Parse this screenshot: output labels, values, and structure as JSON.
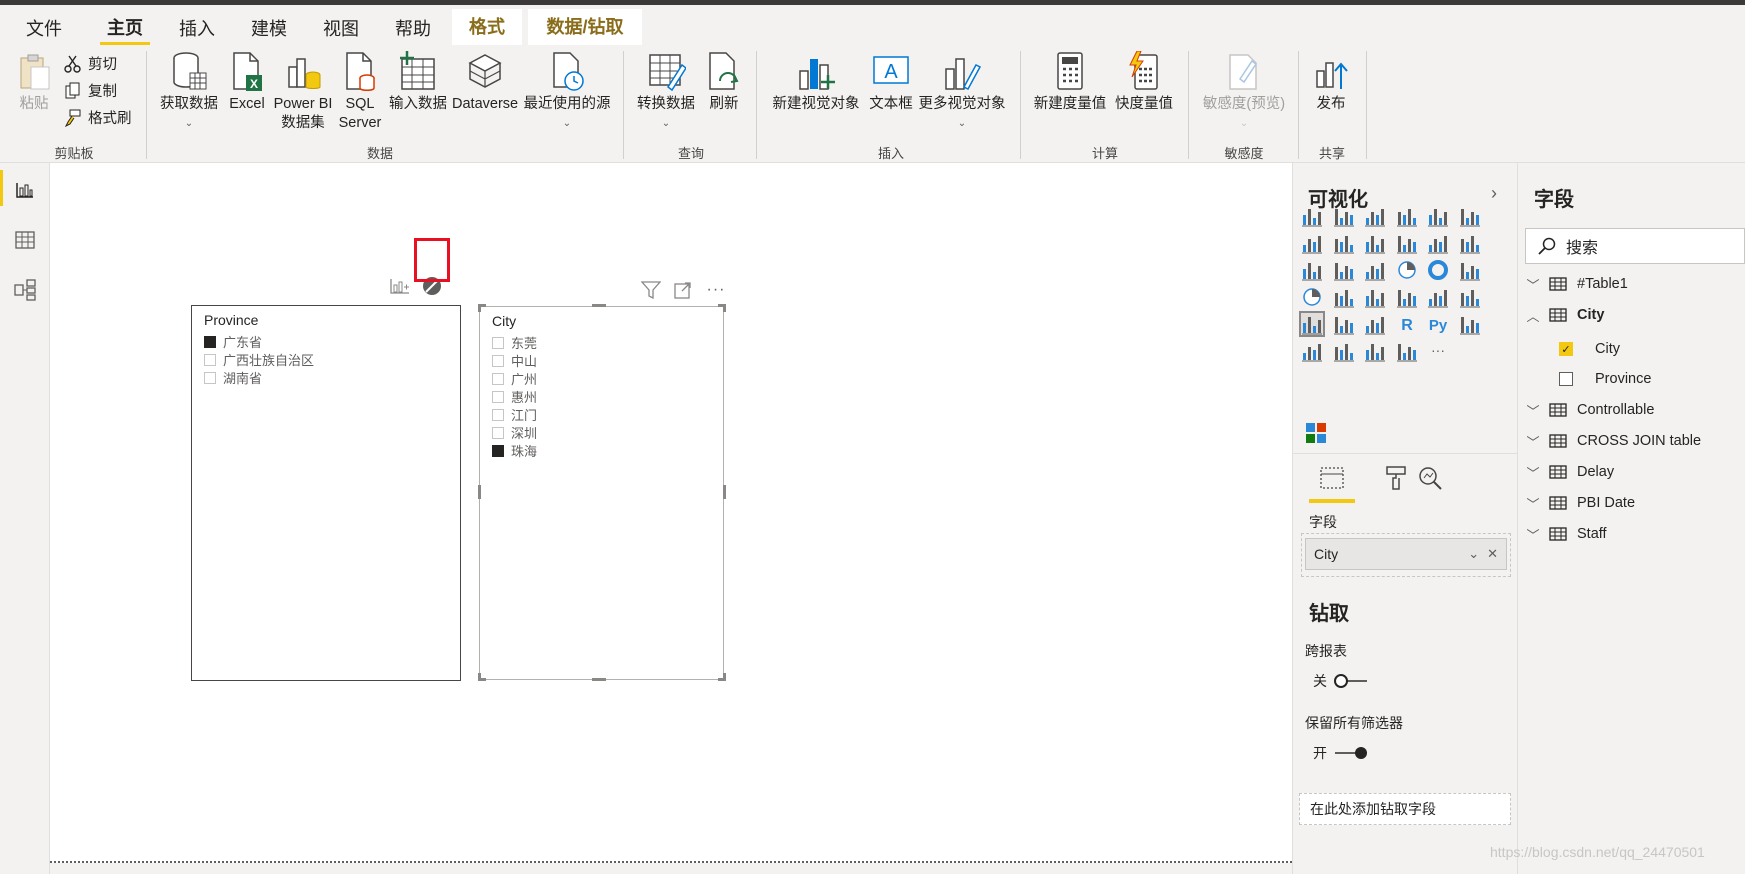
{
  "tabs": [
    "文件",
    "主页",
    "插入",
    "建模",
    "视图",
    "帮助",
    "格式",
    "数据/钻取"
  ],
  "ribbon": {
    "clipboard": {
      "paste": "粘贴",
      "cut": "剪切",
      "copy": "复制",
      "format_painter": "格式刷",
      "group": "剪贴板"
    },
    "data": {
      "get_data": "获取数据",
      "excel": "Excel",
      "pbi_ds_1": "Power BI",
      "pbi_ds_2": "数据集",
      "sql_1": "SQL",
      "sql_2": "Server",
      "enter_data": "输入数据",
      "dataverse": "Dataverse",
      "recent": "最近使用的源",
      "group": "数据"
    },
    "query": {
      "transform": "转换数据",
      "refresh": "刷新",
      "group": "查询"
    },
    "insert": {
      "new_visual": "新建视觉对象",
      "textbox": "文本框",
      "more_visuals": "更多视觉对象",
      "group": "插入"
    },
    "calc": {
      "new_measure": "新建度量值",
      "quick_measure": "快度量值",
      "group": "计算"
    },
    "sensitivity": {
      "label": "敏感度(预览)",
      "group": "敏感度"
    },
    "share": {
      "publish": "发布",
      "group": "共享"
    }
  },
  "slicer_province": {
    "title": "Province",
    "items": [
      {
        "label": "广东省",
        "checked": true
      },
      {
        "label": "广西壮族自治区",
        "checked": false
      },
      {
        "label": "湖南省",
        "checked": false
      }
    ]
  },
  "slicer_city": {
    "title": "City",
    "items": [
      {
        "label": "东莞",
        "checked": false
      },
      {
        "label": "中山",
        "checked": false
      },
      {
        "label": "广州",
        "checked": false
      },
      {
        "label": "惠州",
        "checked": false
      },
      {
        "label": "江门",
        "checked": false
      },
      {
        "label": "深圳",
        "checked": false
      },
      {
        "label": "珠海",
        "checked": true
      }
    ]
  },
  "viz_panel": {
    "title": "可视化",
    "fields_label": "字段",
    "field_well_value": "City",
    "drill_title": "钻取",
    "cross_report": "跨报表",
    "cross_report_state": "关",
    "keep_filters": "保留所有筛选器",
    "keep_filters_state": "开",
    "add_drill_field": "在此处添加钻取字段"
  },
  "fields_panel": {
    "title": "字段",
    "search_placeholder": "搜索",
    "tables": [
      {
        "name": "#Table1",
        "expanded": false
      },
      {
        "name": "City",
        "expanded": true,
        "bold": true,
        "children": [
          {
            "name": "City",
            "checked": true
          },
          {
            "name": "Province",
            "checked": false
          }
        ]
      },
      {
        "name": "Controllable",
        "expanded": false
      },
      {
        "name": "CROSS JOIN table",
        "expanded": false
      },
      {
        "name": "Delay",
        "expanded": false
      },
      {
        "name": "PBI Date",
        "expanded": false
      },
      {
        "name": "Staff",
        "expanded": false
      }
    ]
  },
  "watermark": "https://blog.csdn.net/qq_24470501",
  "colors": {
    "accent": "#f2c811",
    "highlight_box": "#e81123"
  }
}
